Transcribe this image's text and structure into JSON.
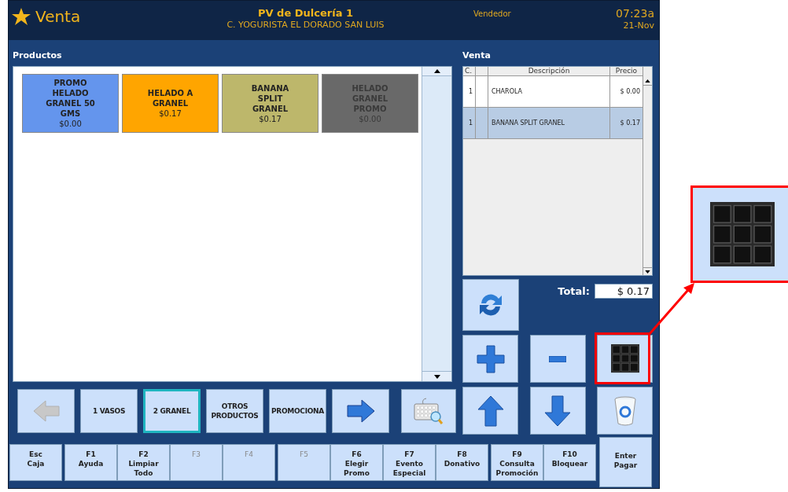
{
  "header": {
    "title": "Venta",
    "store": "PV de Dulcería 1",
    "branch": "C. YOGURISTA EL DORADO SAN LUIS",
    "role": "Vendedor",
    "time": "07:23a",
    "date": "21-Nov"
  },
  "products": {
    "label": "Productos",
    "items": [
      {
        "name": "PROMO HELADO GRANEL 50 GMS",
        "price": "$0.00",
        "color": "#6495ed",
        "dim": false
      },
      {
        "name": "HELADO A GRANEL",
        "price": "$0.17",
        "color": "#ffa500",
        "dim": false
      },
      {
        "name": "BANANA SPLIT GRANEL",
        "price": "$0.17",
        "color": "#bdb76b",
        "dim": false
      },
      {
        "name": "HELADO GRANEL PROMO",
        "price": "$0.00",
        "color": "#696969",
        "dim": true
      }
    ]
  },
  "categories": [
    {
      "kind": "prev",
      "disabled": true,
      "selected": false
    },
    {
      "kind": "text",
      "label": "1 VASOS",
      "selected": false
    },
    {
      "kind": "text",
      "label": "2 GRANEL",
      "selected": true
    },
    {
      "kind": "text",
      "label": "OTROS PRODUCTOS",
      "selected": false
    },
    {
      "kind": "text",
      "label": "PROMOCIONA",
      "selected": false
    },
    {
      "kind": "next",
      "disabled": false,
      "selected": false
    },
    {
      "kind": "search",
      "selected": false
    }
  ],
  "sale": {
    "label": "Venta",
    "columns": [
      "C.",
      "Descripción",
      "Precio"
    ],
    "rows": [
      {
        "qty": "1",
        "description": "CHAROLA",
        "price": "$ 0.00",
        "selected": false
      },
      {
        "qty": "1",
        "description": "BANANA SPLIT GRANEL",
        "price": "$ 0.17",
        "selected": true
      }
    ],
    "total_label": "Total:",
    "total": "$ 0.17"
  },
  "actions": [
    {
      "kind": "refresh"
    },
    {
      "kind": "plus"
    },
    {
      "kind": "minus"
    },
    {
      "kind": "keypad"
    },
    {
      "kind": "up"
    },
    {
      "kind": "down"
    },
    {
      "kind": "trash"
    }
  ],
  "function_key_groups": [
    [
      {
        "key": "Esc",
        "lines": [
          "Caja"
        ],
        "disabled": false
      }
    ],
    [
      {
        "key": "F1",
        "lines": [
          "Ayuda"
        ],
        "disabled": false
      },
      {
        "key": "F2",
        "lines": [
          "Limpiar",
          "Todo"
        ],
        "disabled": false
      },
      {
        "key": "F3",
        "disabled": true
      },
      {
        "key": "F4",
        "disabled": true
      }
    ],
    [
      {
        "key": "F5",
        "disabled": true
      },
      {
        "key": "F6",
        "lines": [
          "Elegir",
          "Promo"
        ],
        "disabled": false
      },
      {
        "key": "F7",
        "lines": [
          "Evento",
          "Especial"
        ],
        "disabled": false
      },
      {
        "key": "F8",
        "lines": [
          "Donativo"
        ],
        "disabled": false
      }
    ],
    [
      {
        "key": "F9",
        "lines": [
          "Consulta",
          "Promoción"
        ],
        "disabled": false
      },
      {
        "key": "F10",
        "lines": [
          "Bloquear"
        ],
        "disabled": false
      }
    ]
  ],
  "enter_key": {
    "key": "Enter",
    "lines": [
      "Pagar"
    ]
  }
}
